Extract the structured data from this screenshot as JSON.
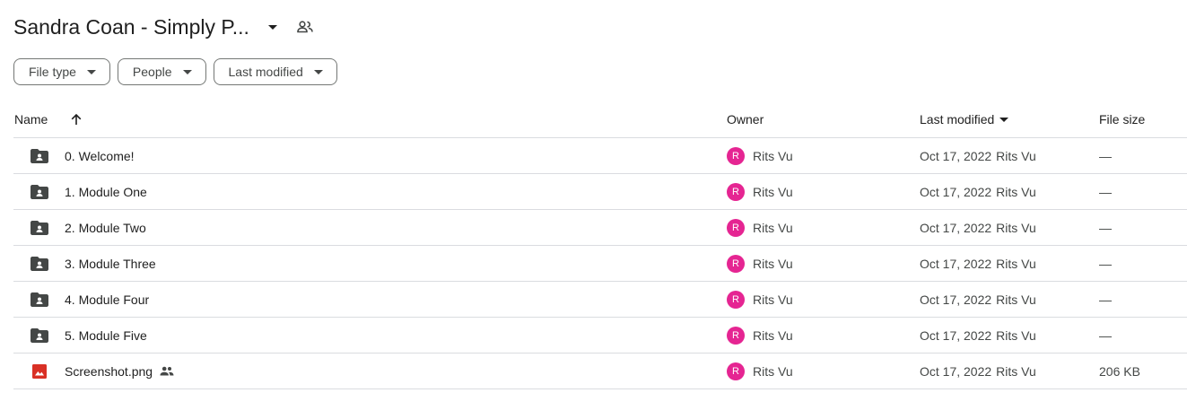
{
  "header": {
    "title": "Sandra Coan - Simply P...",
    "title_menu_icon": "caret-down-icon",
    "shared_icon": "people-outline-icon"
  },
  "filters": [
    {
      "label": "File type",
      "icon": "caret-down-icon"
    },
    {
      "label": "People",
      "icon": "caret-down-icon"
    },
    {
      "label": "Last modified",
      "icon": "caret-down-icon"
    }
  ],
  "table": {
    "columns": {
      "name": "Name",
      "owner": "Owner",
      "modified": "Last modified",
      "size": "File size"
    },
    "sort_icon": "arrow-up-icon",
    "rows": [
      {
        "icon": "shared-folder-icon",
        "name": "0. Welcome!",
        "owner_initial": "R",
        "owner": "Rits Vu",
        "modified_date": "Oct 17, 2022",
        "modified_by": "Rits Vu",
        "size": "—"
      },
      {
        "icon": "shared-folder-icon",
        "name": "1. Module One",
        "owner_initial": "R",
        "owner": "Rits Vu",
        "modified_date": "Oct 17, 2022",
        "modified_by": "Rits Vu",
        "size": "—"
      },
      {
        "icon": "shared-folder-icon",
        "name": "2. Module Two",
        "owner_initial": "R",
        "owner": "Rits Vu",
        "modified_date": "Oct 17, 2022",
        "modified_by": "Rits Vu",
        "size": "—"
      },
      {
        "icon": "shared-folder-icon",
        "name": "3. Module Three",
        "owner_initial": "R",
        "owner": "Rits Vu",
        "modified_date": "Oct 17, 2022",
        "modified_by": "Rits Vu",
        "size": "—"
      },
      {
        "icon": "shared-folder-icon",
        "name": "4. Module Four",
        "owner_initial": "R",
        "owner": "Rits Vu",
        "modified_date": "Oct 17, 2022",
        "modified_by": "Rits Vu",
        "size": "—"
      },
      {
        "icon": "shared-folder-icon",
        "name": "5. Module Five",
        "owner_initial": "R",
        "owner": "Rits Vu",
        "modified_date": "Oct 17, 2022",
        "modified_by": "Rits Vu",
        "size": "—"
      },
      {
        "icon": "image-file-icon",
        "name": "Screenshot.png",
        "shared": true,
        "owner_initial": "R",
        "owner": "Rits Vu",
        "modified_date": "Oct 17, 2022",
        "modified_by": "Rits Vu",
        "size": "206 KB"
      }
    ]
  },
  "colors": {
    "avatar": "#e52592",
    "folder_icon": "#444746",
    "image_icon": "#d93025",
    "divider": "#dadce0"
  }
}
